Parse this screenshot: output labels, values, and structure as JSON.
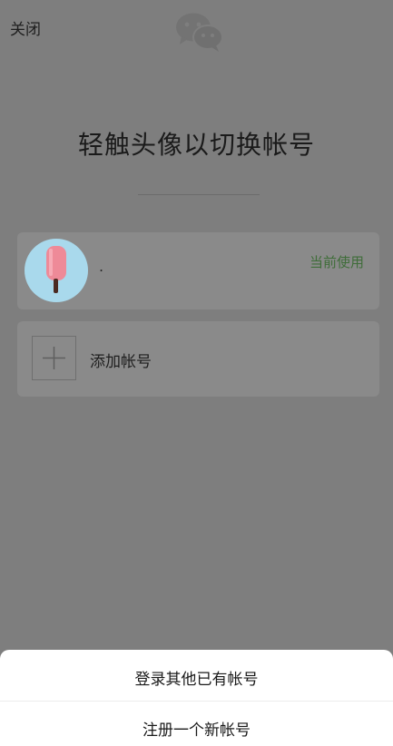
{
  "header": {
    "close_label": "关闭"
  },
  "main": {
    "title": "轻触头像以切换帐号"
  },
  "account": {
    "name": ".",
    "current_badge": "当前使用"
  },
  "add_account": {
    "label": "添加帐号"
  },
  "sheet": {
    "login_existing": "登录其他已有帐号",
    "register_new": "注册一个新帐号"
  },
  "colors": {
    "overlay": "#7e7e7e",
    "card": "#8a8a8a",
    "current_green": "#3f6d39",
    "avatar_bg": "#a9d9ec",
    "sheet_bg": "#ffffff"
  }
}
